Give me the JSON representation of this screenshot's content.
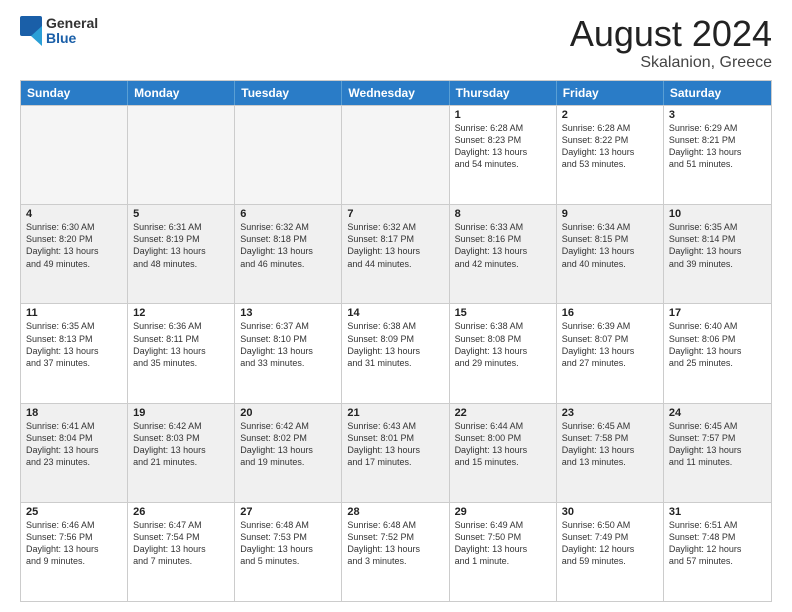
{
  "header": {
    "logo_general": "General",
    "logo_blue": "Blue",
    "title": "August 2024",
    "location": "Skalanion, Greece"
  },
  "weekdays": [
    "Sunday",
    "Monday",
    "Tuesday",
    "Wednesday",
    "Thursday",
    "Friday",
    "Saturday"
  ],
  "rows": [
    [
      {
        "num": "",
        "info": "",
        "empty": true
      },
      {
        "num": "",
        "info": "",
        "empty": true
      },
      {
        "num": "",
        "info": "",
        "empty": true
      },
      {
        "num": "",
        "info": "",
        "empty": true
      },
      {
        "num": "1",
        "info": "Sunrise: 6:28 AM\nSunset: 8:23 PM\nDaylight: 13 hours\nand 54 minutes."
      },
      {
        "num": "2",
        "info": "Sunrise: 6:28 AM\nSunset: 8:22 PM\nDaylight: 13 hours\nand 53 minutes."
      },
      {
        "num": "3",
        "info": "Sunrise: 6:29 AM\nSunset: 8:21 PM\nDaylight: 13 hours\nand 51 minutes."
      }
    ],
    [
      {
        "num": "4",
        "info": "Sunrise: 6:30 AM\nSunset: 8:20 PM\nDaylight: 13 hours\nand 49 minutes."
      },
      {
        "num": "5",
        "info": "Sunrise: 6:31 AM\nSunset: 8:19 PM\nDaylight: 13 hours\nand 48 minutes."
      },
      {
        "num": "6",
        "info": "Sunrise: 6:32 AM\nSunset: 8:18 PM\nDaylight: 13 hours\nand 46 minutes."
      },
      {
        "num": "7",
        "info": "Sunrise: 6:32 AM\nSunset: 8:17 PM\nDaylight: 13 hours\nand 44 minutes."
      },
      {
        "num": "8",
        "info": "Sunrise: 6:33 AM\nSunset: 8:16 PM\nDaylight: 13 hours\nand 42 minutes."
      },
      {
        "num": "9",
        "info": "Sunrise: 6:34 AM\nSunset: 8:15 PM\nDaylight: 13 hours\nand 40 minutes."
      },
      {
        "num": "10",
        "info": "Sunrise: 6:35 AM\nSunset: 8:14 PM\nDaylight: 13 hours\nand 39 minutes."
      }
    ],
    [
      {
        "num": "11",
        "info": "Sunrise: 6:35 AM\nSunset: 8:13 PM\nDaylight: 13 hours\nand 37 minutes."
      },
      {
        "num": "12",
        "info": "Sunrise: 6:36 AM\nSunset: 8:11 PM\nDaylight: 13 hours\nand 35 minutes."
      },
      {
        "num": "13",
        "info": "Sunrise: 6:37 AM\nSunset: 8:10 PM\nDaylight: 13 hours\nand 33 minutes."
      },
      {
        "num": "14",
        "info": "Sunrise: 6:38 AM\nSunset: 8:09 PM\nDaylight: 13 hours\nand 31 minutes."
      },
      {
        "num": "15",
        "info": "Sunrise: 6:38 AM\nSunset: 8:08 PM\nDaylight: 13 hours\nand 29 minutes."
      },
      {
        "num": "16",
        "info": "Sunrise: 6:39 AM\nSunset: 8:07 PM\nDaylight: 13 hours\nand 27 minutes."
      },
      {
        "num": "17",
        "info": "Sunrise: 6:40 AM\nSunset: 8:06 PM\nDaylight: 13 hours\nand 25 minutes."
      }
    ],
    [
      {
        "num": "18",
        "info": "Sunrise: 6:41 AM\nSunset: 8:04 PM\nDaylight: 13 hours\nand 23 minutes."
      },
      {
        "num": "19",
        "info": "Sunrise: 6:42 AM\nSunset: 8:03 PM\nDaylight: 13 hours\nand 21 minutes."
      },
      {
        "num": "20",
        "info": "Sunrise: 6:42 AM\nSunset: 8:02 PM\nDaylight: 13 hours\nand 19 minutes."
      },
      {
        "num": "21",
        "info": "Sunrise: 6:43 AM\nSunset: 8:01 PM\nDaylight: 13 hours\nand 17 minutes."
      },
      {
        "num": "22",
        "info": "Sunrise: 6:44 AM\nSunset: 8:00 PM\nDaylight: 13 hours\nand 15 minutes."
      },
      {
        "num": "23",
        "info": "Sunrise: 6:45 AM\nSunset: 7:58 PM\nDaylight: 13 hours\nand 13 minutes."
      },
      {
        "num": "24",
        "info": "Sunrise: 6:45 AM\nSunset: 7:57 PM\nDaylight: 13 hours\nand 11 minutes."
      }
    ],
    [
      {
        "num": "25",
        "info": "Sunrise: 6:46 AM\nSunset: 7:56 PM\nDaylight: 13 hours\nand 9 minutes."
      },
      {
        "num": "26",
        "info": "Sunrise: 6:47 AM\nSunset: 7:54 PM\nDaylight: 13 hours\nand 7 minutes."
      },
      {
        "num": "27",
        "info": "Sunrise: 6:48 AM\nSunset: 7:53 PM\nDaylight: 13 hours\nand 5 minutes."
      },
      {
        "num": "28",
        "info": "Sunrise: 6:48 AM\nSunset: 7:52 PM\nDaylight: 13 hours\nand 3 minutes."
      },
      {
        "num": "29",
        "info": "Sunrise: 6:49 AM\nSunset: 7:50 PM\nDaylight: 13 hours\nand 1 minute."
      },
      {
        "num": "30",
        "info": "Sunrise: 6:50 AM\nSunset: 7:49 PM\nDaylight: 12 hours\nand 59 minutes."
      },
      {
        "num": "31",
        "info": "Sunrise: 6:51 AM\nSunset: 7:48 PM\nDaylight: 12 hours\nand 57 minutes."
      }
    ]
  ]
}
